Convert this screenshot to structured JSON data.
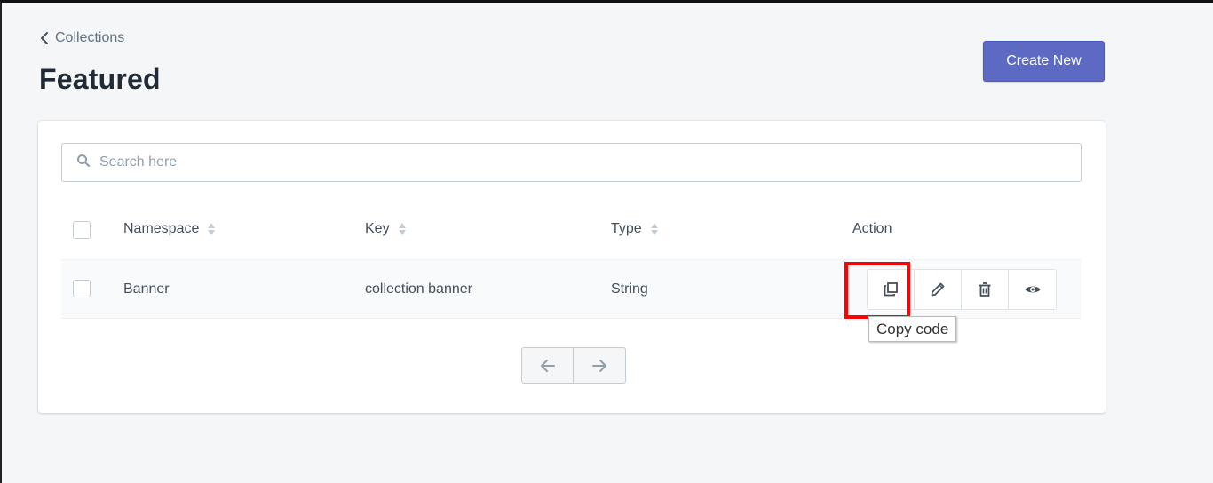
{
  "breadcrumb": {
    "label": "Collections"
  },
  "page": {
    "title": "Featured"
  },
  "header": {
    "create_label": "Create New"
  },
  "search": {
    "placeholder": "Search here",
    "value": ""
  },
  "table": {
    "columns": [
      "Namespace",
      "Key",
      "Type",
      "Action"
    ],
    "rows": [
      {
        "namespace": "Banner",
        "key": "collection banner",
        "type": "String"
      }
    ]
  },
  "tooltip": {
    "text": "Copy code"
  },
  "colors": {
    "accent": "#5c6ac4",
    "highlight": "#ff0000",
    "background": "#f4f6f8"
  },
  "icons": {
    "back": "chevron-left-icon",
    "search": "search-icon",
    "copy": "copy-icon",
    "edit": "pencil-icon",
    "delete": "trash-icon",
    "view": "eye-icon",
    "prev": "arrow-left-icon",
    "next": "arrow-right-icon"
  }
}
